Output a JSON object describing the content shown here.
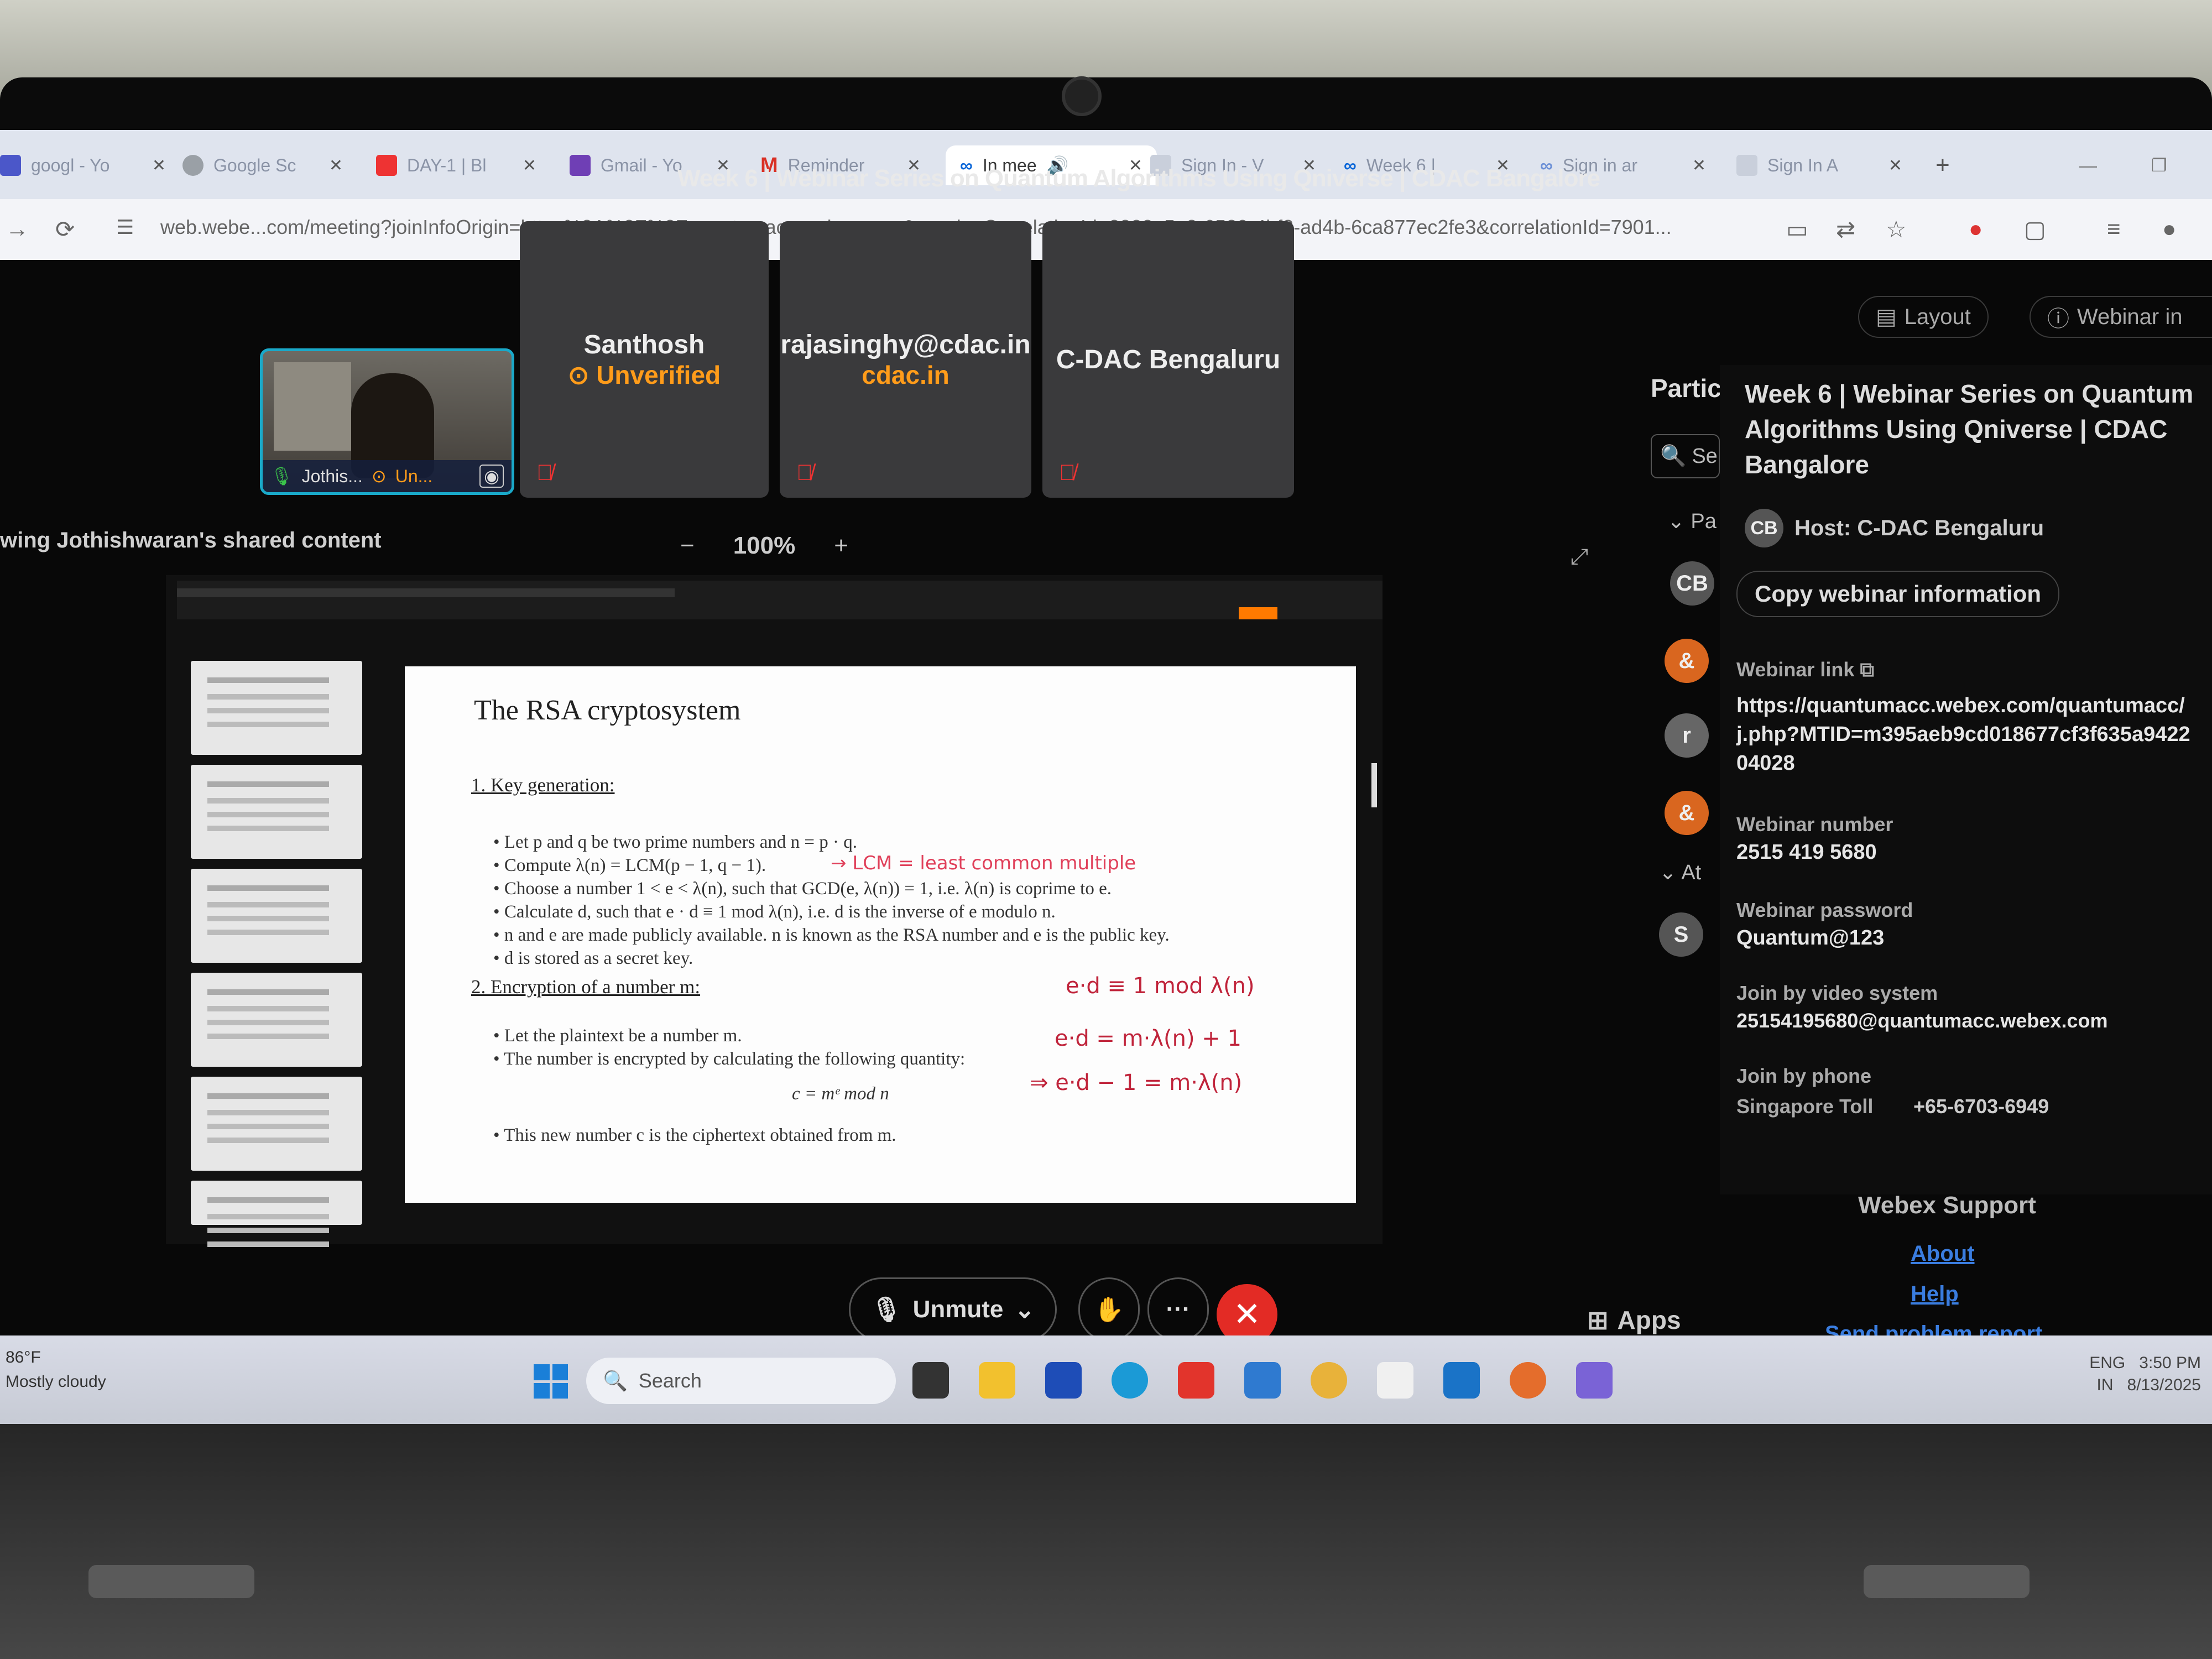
{
  "browser": {
    "tabs": [
      {
        "label": "googl - Yo",
        "icon_color": "#4b57c9"
      },
      {
        "label": "Google Sc",
        "icon_color": "#9aa0a6"
      },
      {
        "label": "DAY-1 | Bl",
        "icon_color": "#e33"
      },
      {
        "label": "Gmail - Yo",
        "icon_color": "#6f3fb5"
      },
      {
        "label": "Reminder",
        "icon_color": "#d93025"
      },
      {
        "label": "In mee",
        "icon_color": "#0a66d8",
        "active": true
      },
      {
        "label": "Sign In - V",
        "icon_color": "#9aa0a6"
      },
      {
        "label": "Week 6 |",
        "icon_color": "#0a66d8"
      },
      {
        "label": "Sign in ar",
        "icon_color": "#9aa0a6"
      },
      {
        "label": "Sign In A",
        "icon_color": "#9aa0a6"
      }
    ],
    "url": "web.webe...com/meeting?joinInfoOrigin=https%3A%2F%2Fquantumacc.webex.com&sessionCorrelationId=2322a5a3-6589-4bf3-ad4b-6ca877ec2fe3&correlationId=7901..."
  },
  "meeting": {
    "title": "Week 6 | Webinar Series on Quantum Algorithms Using Qniverse | CDAC Bangalore",
    "layout_label": "Layout",
    "webinar_label": "Webinar in",
    "self_video": {
      "name": "Jothis...",
      "status": "Un..."
    },
    "tiles": [
      {
        "name": "Santhosh",
        "sub": "Unverified"
      },
      {
        "name": "rajasinghy@cdac.in",
        "sub": "cdac.in"
      },
      {
        "name": "C-DAC Bengaluru",
        "sub": ""
      }
    ],
    "viewing_label": "wing Jothishwaran's shared content",
    "zoom": "100%",
    "controls": {
      "unmute": "Unmute",
      "more": "···",
      "end": "✕"
    },
    "apps_label": "Apps"
  },
  "slide": {
    "title": "The RSA cryptosystem",
    "section1": "1.  Key generation:",
    "bullets1": [
      "Let p and q be two prime numbers and n = p · q.",
      "Compute λ(n) = LCM(p − 1, q − 1).",
      "Choose a number 1 < e < λ(n), such that GCD(e, λ(n)) = 1, i.e. λ(n) is coprime to e.",
      "Calculate d, such that e · d ≡ 1 mod λ(n),  i.e. d is the inverse of e modulo n.",
      "n and e are made publicly available. n is known as the RSA number and e is the public key.",
      "d is stored as a secret key."
    ],
    "section2": "2.  Encryption of a number m:",
    "bullets2": [
      "Let the plaintext be a number m.",
      "The number is encrypted by calculating the following quantity:"
    ],
    "formula": "c = mᵉ mod n",
    "bullet3": "This new number c is the ciphertext obtained from m.",
    "annotations": {
      "lcm_note": "→ LCM = least common multiple",
      "eq1": "e·d ≡ 1 mod λ(n)",
      "eq2": "e·d = m·λ(n) + 1",
      "eq3": "⇒ e·d − 1 = m·λ(n)"
    }
  },
  "participants": {
    "header": "Partic",
    "search_placeholder": "Se",
    "group1": "Pa",
    "group2": "At",
    "avatars": [
      "CB",
      "&",
      "r",
      "&",
      "S"
    ]
  },
  "info_panel": {
    "title": "Week 6 | Webinar Series on Quantum Algorithms Using Qniverse | CDAC Bangalore",
    "host_initials": "CB",
    "host": "Host: C-DAC Bengaluru",
    "copy_button": "Copy webinar information",
    "webinar_link_label": "Webinar link",
    "webinar_link": "https://quantumacc.webex.com/quantumacc/j.php?MTID=m395aeb9cd018677cf3f635a942204028",
    "webinar_number_label": "Webinar number",
    "webinar_number": "2515 419 5680",
    "password_label": "Webinar password",
    "password": "Quantum@123",
    "video_label": "Join by video system",
    "video": "25154195680@quantumacc.webex.com",
    "phone_label": "Join by phone",
    "phone_region": "Singapore Toll",
    "phone": "+65-6703-6949",
    "support_title": "Webex Support",
    "about": "About",
    "help": "Help",
    "report": "Send problem report"
  },
  "taskbar": {
    "weather_temp": "86°F",
    "weather_text": "Mostly cloudy",
    "search": "Search",
    "lang1": "ENG",
    "lang2": "IN",
    "time": "3:50 PM",
    "date": "8/13/2025",
    "colors": {
      "accent": "#1a7fd8",
      "end_call": "#e32b25",
      "unverified": "#ff9c1a"
    }
  }
}
